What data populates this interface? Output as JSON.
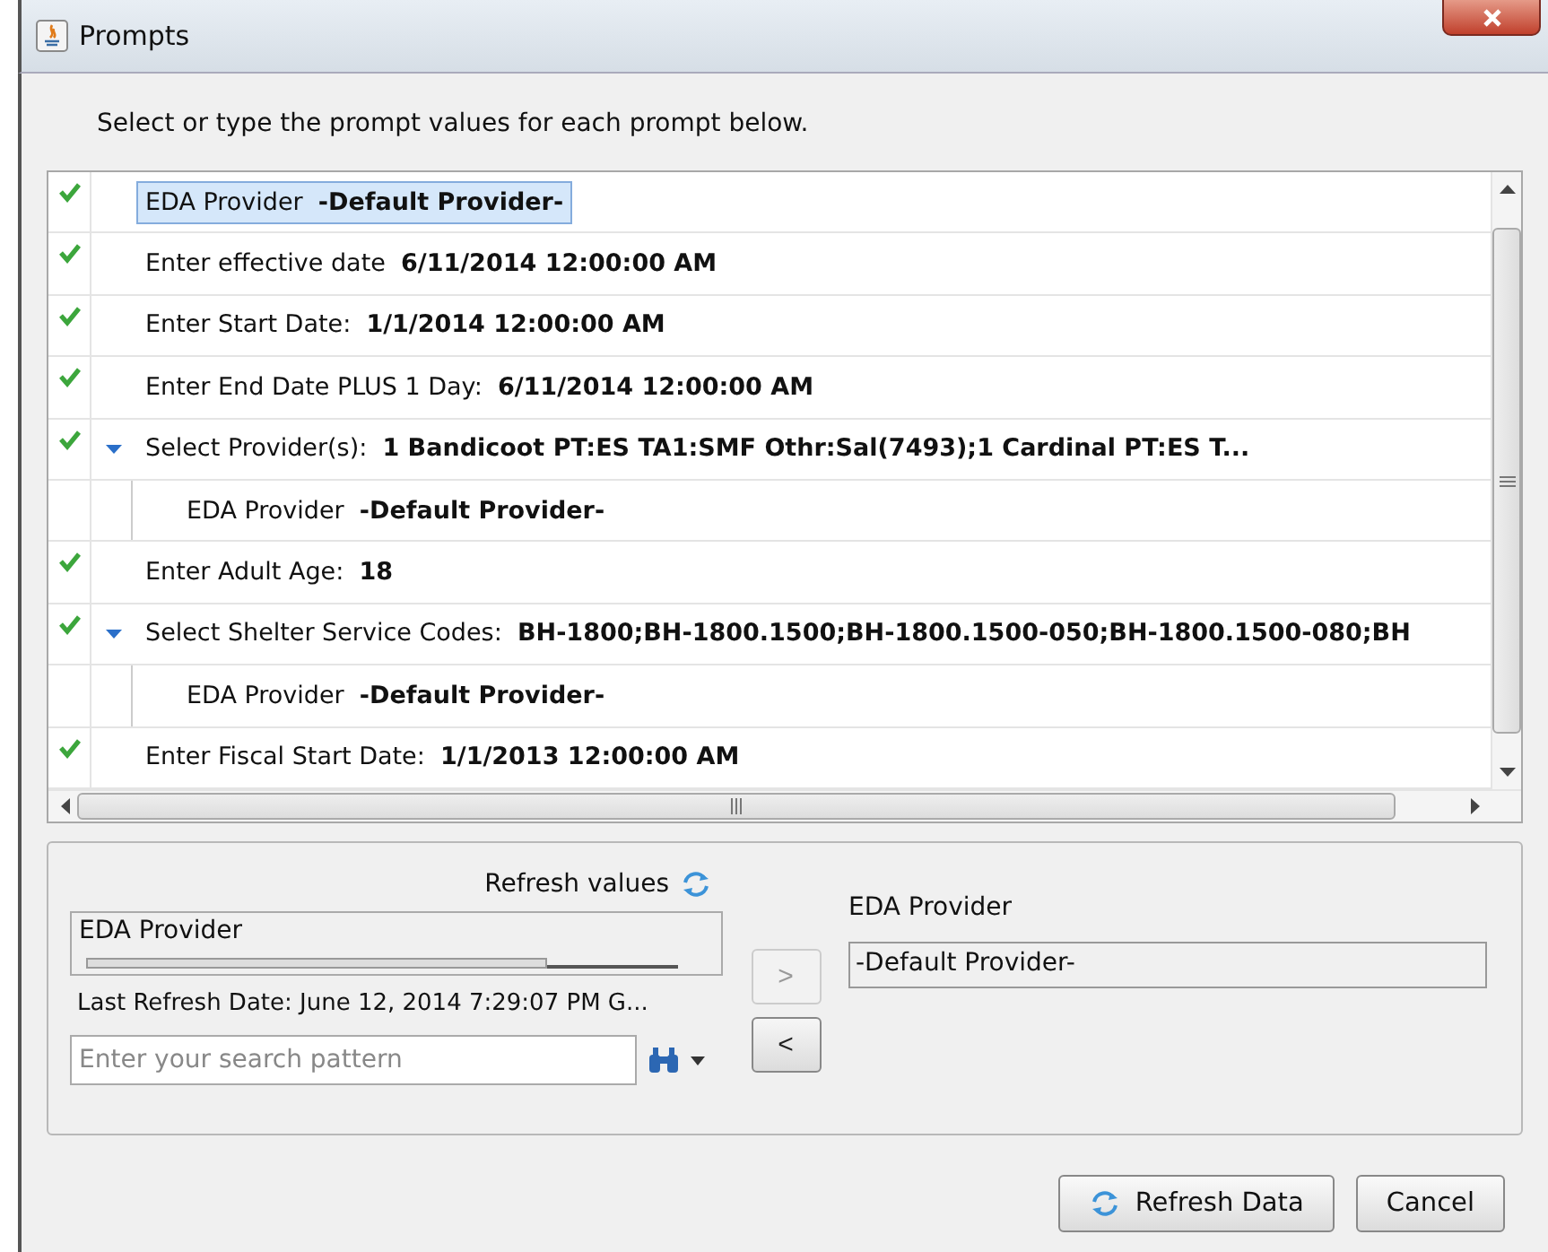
{
  "window": {
    "title": "Prompts"
  },
  "instruction": "Select or type the prompt values for each prompt below.",
  "prompts": [
    {
      "label": "EDA Provider",
      "value": "-Default Provider-",
      "checked": true,
      "selected": true
    },
    {
      "label": "Enter effective date",
      "value": "6/11/2014 12:00:00 AM",
      "checked": true,
      "selected": false
    },
    {
      "label": "Enter Start Date:",
      "value": "1/1/2014 12:00:00 AM",
      "checked": true,
      "selected": false
    },
    {
      "label": "Enter End Date PLUS 1 Day:",
      "value": "6/11/2014 12:00:00 AM",
      "checked": true,
      "selected": false
    },
    {
      "label": "Select Provider(s):",
      "value": "1 Bandicoot PT:ES TA1:SMF Othr:Sal(7493);1 Cardinal PT:ES T...",
      "checked": true,
      "selected": false,
      "expanded": true,
      "children": [
        {
          "label": "EDA Provider",
          "value": "-Default Provider-"
        }
      ]
    },
    {
      "label": "Enter Adult Age:",
      "value": "18",
      "checked": true,
      "selected": false
    },
    {
      "label": "Select Shelter Service Codes:",
      "value": "BH-1800;BH-1800.1500;BH-1800.1500-050;BH-1800.1500-080;BH",
      "checked": true,
      "selected": false,
      "expanded": true,
      "children": [
        {
          "label": "EDA Provider",
          "value": "-Default Provider-"
        }
      ]
    },
    {
      "label": "Enter Fiscal Start Date:",
      "value": "1/1/2013 12:00:00 AM",
      "checked": true,
      "selected": false
    }
  ],
  "values_panel": {
    "refresh_label": "Refresh values",
    "list_items": [
      "EDA Provider"
    ],
    "last_refresh": "Last Refresh Date: June 12, 2014 7:29:07 PM G...",
    "search": {
      "placeholder": "Enter your search pattern"
    },
    "add_button": {
      "label": ">",
      "disabled": true
    },
    "remove_button": {
      "label": "<",
      "disabled": false
    },
    "selected_label": "EDA Provider",
    "selected_value": "-Default Provider-"
  },
  "buttons": [
    {
      "label": "Refresh Data",
      "kind": "refresh"
    },
    {
      "label": "Cancel",
      "kind": "plain"
    }
  ]
}
